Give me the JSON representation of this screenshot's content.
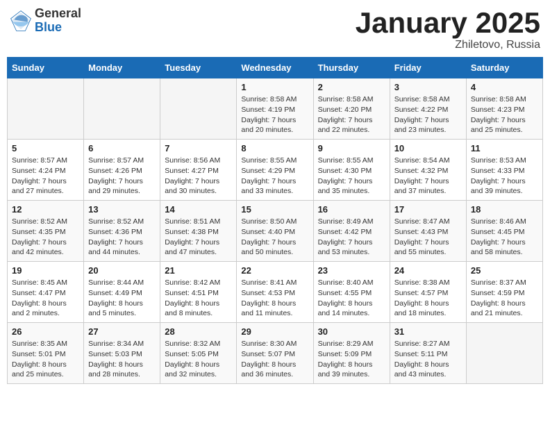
{
  "header": {
    "logo_general": "General",
    "logo_blue": "Blue",
    "month_title": "January 2025",
    "location": "Zhiletovo, Russia"
  },
  "days_of_week": [
    "Sunday",
    "Monday",
    "Tuesday",
    "Wednesday",
    "Thursday",
    "Friday",
    "Saturday"
  ],
  "weeks": [
    [
      {
        "day": "",
        "sunrise": "",
        "sunset": "",
        "daylight": ""
      },
      {
        "day": "",
        "sunrise": "",
        "sunset": "",
        "daylight": ""
      },
      {
        "day": "",
        "sunrise": "",
        "sunset": "",
        "daylight": ""
      },
      {
        "day": "1",
        "sunrise": "Sunrise: 8:58 AM",
        "sunset": "Sunset: 4:19 PM",
        "daylight": "Daylight: 7 hours and 20 minutes."
      },
      {
        "day": "2",
        "sunrise": "Sunrise: 8:58 AM",
        "sunset": "Sunset: 4:20 PM",
        "daylight": "Daylight: 7 hours and 22 minutes."
      },
      {
        "day": "3",
        "sunrise": "Sunrise: 8:58 AM",
        "sunset": "Sunset: 4:22 PM",
        "daylight": "Daylight: 7 hours and 23 minutes."
      },
      {
        "day": "4",
        "sunrise": "Sunrise: 8:58 AM",
        "sunset": "Sunset: 4:23 PM",
        "daylight": "Daylight: 7 hours and 25 minutes."
      }
    ],
    [
      {
        "day": "5",
        "sunrise": "Sunrise: 8:57 AM",
        "sunset": "Sunset: 4:24 PM",
        "daylight": "Daylight: 7 hours and 27 minutes."
      },
      {
        "day": "6",
        "sunrise": "Sunrise: 8:57 AM",
        "sunset": "Sunset: 4:26 PM",
        "daylight": "Daylight: 7 hours and 29 minutes."
      },
      {
        "day": "7",
        "sunrise": "Sunrise: 8:56 AM",
        "sunset": "Sunset: 4:27 PM",
        "daylight": "Daylight: 7 hours and 30 minutes."
      },
      {
        "day": "8",
        "sunrise": "Sunrise: 8:55 AM",
        "sunset": "Sunset: 4:29 PM",
        "daylight": "Daylight: 7 hours and 33 minutes."
      },
      {
        "day": "9",
        "sunrise": "Sunrise: 8:55 AM",
        "sunset": "Sunset: 4:30 PM",
        "daylight": "Daylight: 7 hours and 35 minutes."
      },
      {
        "day": "10",
        "sunrise": "Sunrise: 8:54 AM",
        "sunset": "Sunset: 4:32 PM",
        "daylight": "Daylight: 7 hours and 37 minutes."
      },
      {
        "day": "11",
        "sunrise": "Sunrise: 8:53 AM",
        "sunset": "Sunset: 4:33 PM",
        "daylight": "Daylight: 7 hours and 39 minutes."
      }
    ],
    [
      {
        "day": "12",
        "sunrise": "Sunrise: 8:52 AM",
        "sunset": "Sunset: 4:35 PM",
        "daylight": "Daylight: 7 hours and 42 minutes."
      },
      {
        "day": "13",
        "sunrise": "Sunrise: 8:52 AM",
        "sunset": "Sunset: 4:36 PM",
        "daylight": "Daylight: 7 hours and 44 minutes."
      },
      {
        "day": "14",
        "sunrise": "Sunrise: 8:51 AM",
        "sunset": "Sunset: 4:38 PM",
        "daylight": "Daylight: 7 hours and 47 minutes."
      },
      {
        "day": "15",
        "sunrise": "Sunrise: 8:50 AM",
        "sunset": "Sunset: 4:40 PM",
        "daylight": "Daylight: 7 hours and 50 minutes."
      },
      {
        "day": "16",
        "sunrise": "Sunrise: 8:49 AM",
        "sunset": "Sunset: 4:42 PM",
        "daylight": "Daylight: 7 hours and 53 minutes."
      },
      {
        "day": "17",
        "sunrise": "Sunrise: 8:47 AM",
        "sunset": "Sunset: 4:43 PM",
        "daylight": "Daylight: 7 hours and 55 minutes."
      },
      {
        "day": "18",
        "sunrise": "Sunrise: 8:46 AM",
        "sunset": "Sunset: 4:45 PM",
        "daylight": "Daylight: 7 hours and 58 minutes."
      }
    ],
    [
      {
        "day": "19",
        "sunrise": "Sunrise: 8:45 AM",
        "sunset": "Sunset: 4:47 PM",
        "daylight": "Daylight: 8 hours and 2 minutes."
      },
      {
        "day": "20",
        "sunrise": "Sunrise: 8:44 AM",
        "sunset": "Sunset: 4:49 PM",
        "daylight": "Daylight: 8 hours and 5 minutes."
      },
      {
        "day": "21",
        "sunrise": "Sunrise: 8:42 AM",
        "sunset": "Sunset: 4:51 PM",
        "daylight": "Daylight: 8 hours and 8 minutes."
      },
      {
        "day": "22",
        "sunrise": "Sunrise: 8:41 AM",
        "sunset": "Sunset: 4:53 PM",
        "daylight": "Daylight: 8 hours and 11 minutes."
      },
      {
        "day": "23",
        "sunrise": "Sunrise: 8:40 AM",
        "sunset": "Sunset: 4:55 PM",
        "daylight": "Daylight: 8 hours and 14 minutes."
      },
      {
        "day": "24",
        "sunrise": "Sunrise: 8:38 AM",
        "sunset": "Sunset: 4:57 PM",
        "daylight": "Daylight: 8 hours and 18 minutes."
      },
      {
        "day": "25",
        "sunrise": "Sunrise: 8:37 AM",
        "sunset": "Sunset: 4:59 PM",
        "daylight": "Daylight: 8 hours and 21 minutes."
      }
    ],
    [
      {
        "day": "26",
        "sunrise": "Sunrise: 8:35 AM",
        "sunset": "Sunset: 5:01 PM",
        "daylight": "Daylight: 8 hours and 25 minutes."
      },
      {
        "day": "27",
        "sunrise": "Sunrise: 8:34 AM",
        "sunset": "Sunset: 5:03 PM",
        "daylight": "Daylight: 8 hours and 28 minutes."
      },
      {
        "day": "28",
        "sunrise": "Sunrise: 8:32 AM",
        "sunset": "Sunset: 5:05 PM",
        "daylight": "Daylight: 8 hours and 32 minutes."
      },
      {
        "day": "29",
        "sunrise": "Sunrise: 8:30 AM",
        "sunset": "Sunset: 5:07 PM",
        "daylight": "Daylight: 8 hours and 36 minutes."
      },
      {
        "day": "30",
        "sunrise": "Sunrise: 8:29 AM",
        "sunset": "Sunset: 5:09 PM",
        "daylight": "Daylight: 8 hours and 39 minutes."
      },
      {
        "day": "31",
        "sunrise": "Sunrise: 8:27 AM",
        "sunset": "Sunset: 5:11 PM",
        "daylight": "Daylight: 8 hours and 43 minutes."
      },
      {
        "day": "",
        "sunrise": "",
        "sunset": "",
        "daylight": ""
      }
    ]
  ]
}
